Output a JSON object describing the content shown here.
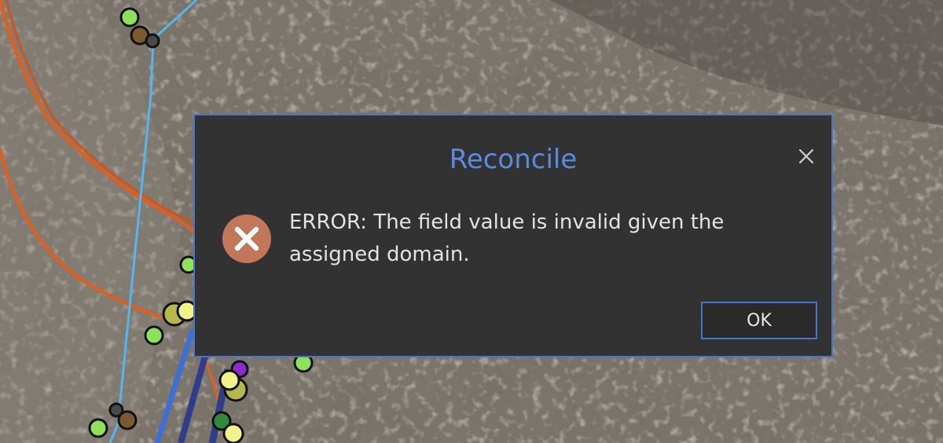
{
  "dialog": {
    "title": "Reconcile",
    "message": "ERROR: The field value is invalid given the assigned domain.",
    "ok_label": "OK",
    "close_icon": "close-icon",
    "status_icon": "error-icon"
  },
  "colors": {
    "dialog_bg": "#323232",
    "accent": "#4a74c9",
    "title": "#5b8be0",
    "error_icon": "#c2775a"
  }
}
